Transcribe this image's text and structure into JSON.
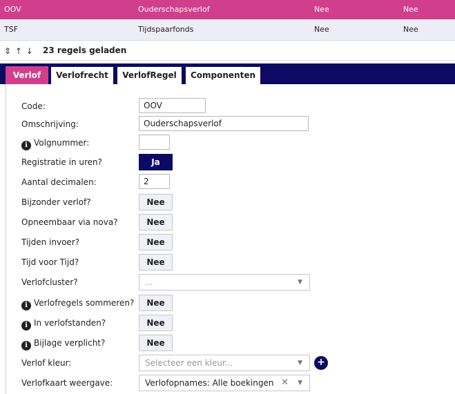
{
  "grid": {
    "rows": [
      {
        "code": "OOV",
        "name": "Ouderschapsverlof",
        "col3": "Nee",
        "col4": "Nee"
      },
      {
        "code": "TSF",
        "name": "Tijdspaarfonds",
        "col3": "Nee",
        "col4": "Nee"
      }
    ]
  },
  "status": {
    "arrows": "⇕ ↑ ↓",
    "count_label": "23 regels geladen"
  },
  "tabs": [
    "Verlof",
    "Verlofrecht",
    "VerlofRegel",
    "Componenten"
  ],
  "form": {
    "code": {
      "label": "Code:",
      "value": "OOV"
    },
    "omschrijving": {
      "label": "Omschrijving:",
      "value": "Ouderschapsverlof"
    },
    "volgnummer": {
      "label": "Volgnummer:",
      "value": ""
    },
    "registratie": {
      "label": "Registratie in uren?",
      "value": "Ja"
    },
    "decimalen": {
      "label": "Aantal decimalen:",
      "value": "2"
    },
    "bijzonder": {
      "label": "Bijzonder verlof?",
      "value": "Nee"
    },
    "opneembaar": {
      "label": "Opneembaar via nova?",
      "value": "Nee"
    },
    "tijden": {
      "label": "Tijden invoer?",
      "value": "Nee"
    },
    "tijdvoortijd": {
      "label": "Tijd voor Tijd?",
      "value": "Nee"
    },
    "verlofcluster": {
      "label": "Verlofcluster?",
      "placeholder": "..."
    },
    "sommeren": {
      "label": "Verlofregels sommeren?",
      "value": "Nee"
    },
    "verlofstanden": {
      "label": "In verlofstanden?",
      "value": "Nee"
    },
    "bijlage": {
      "label": "Bijlage verplicht?",
      "value": "Nee"
    },
    "kleur": {
      "label": "Verlof kleur:",
      "placeholder": "Selecteer een kleur..."
    },
    "weergave": {
      "label": "Verlofkaart weergave:",
      "value": "Verlofopnames: Alle boekingen"
    }
  },
  "icons": {
    "info": "i",
    "plus": "+",
    "caret": "▼",
    "clear": "✕"
  },
  "colors": {
    "accent_pink": "#d13f8c",
    "navy": "#0d0a64"
  }
}
